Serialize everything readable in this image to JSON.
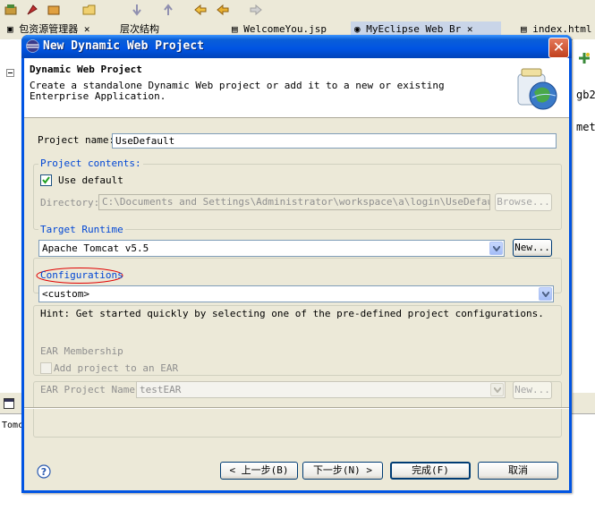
{
  "ide": {
    "tabs": [
      {
        "label": "包资源管理器"
      },
      {
        "label": "层次结构"
      },
      {
        "label": "WelcomeYou.jsp"
      },
      {
        "label": "MyEclipse Web Br"
      },
      {
        "label": "index.html"
      }
    ],
    "right_text_1": "gb2",
    "right_text_2": "met",
    "bottom_label": "Tomc"
  },
  "dialog": {
    "title": "New Dynamic Web Project",
    "header_title": "Dynamic Web Project",
    "header_description": "Create a standalone Dynamic Web project or add it to a new or existing Enterprise Application.",
    "project_name_label": "Project name:",
    "project_name_value": "UseDefault",
    "project_contents": {
      "title": "Project contents:",
      "use_default_label": "Use default",
      "use_default_checked": true,
      "directory_label": "Directory:",
      "directory_value": "C:\\Documents and Settings\\Administrator\\workspace\\a\\login\\UseDefault",
      "browse_label": "Browse..."
    },
    "target_runtime": {
      "title": "Target Runtime",
      "selected": "Apache Tomcat v5.5",
      "new_label": "New..."
    },
    "configurations": {
      "title": "Configurations",
      "selected": "<custom>",
      "hint": "Hint: Get started quickly by selecting one of the pre-defined project configurations."
    },
    "ear_membership": {
      "title": "EAR Membership",
      "add_label": "Add project to an EAR",
      "ear_name_label": "EAR Project Name:",
      "ear_name_value": "testEAR",
      "new_label": "New..."
    },
    "buttons": {
      "back": "< 上一步(B)",
      "next": "下一步(N) >",
      "finish": "完成(F)",
      "cancel": "取消"
    },
    "colors": {
      "titlebar": "#0054e3",
      "group_title": "#0046d5",
      "highlight_ellipse": "#e00000"
    }
  }
}
